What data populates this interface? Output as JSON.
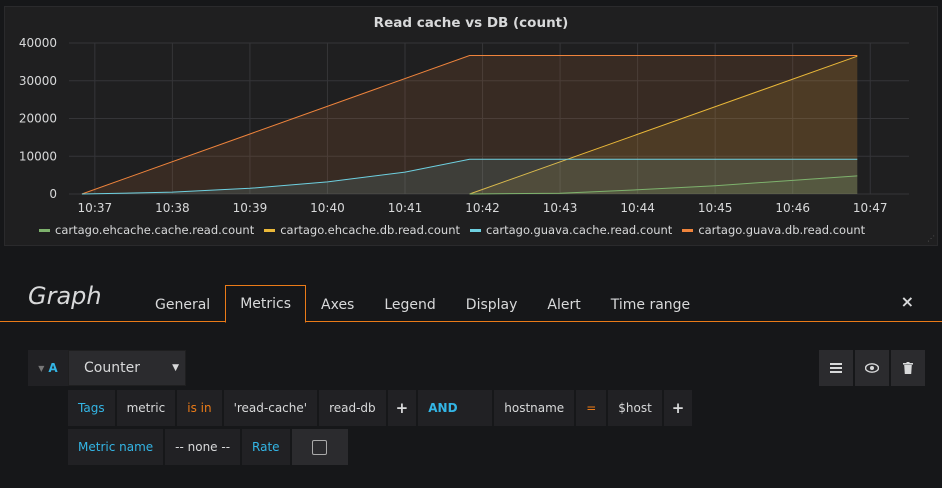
{
  "panel": {
    "title": "Read cache vs DB (count)"
  },
  "chart_data": {
    "type": "area",
    "title": "Read cache vs DB (count)",
    "xlabel": "",
    "ylabel": "",
    "ylim": [
      0,
      40000
    ],
    "yticks": [
      0,
      10000,
      20000,
      30000,
      40000
    ],
    "yticklabels": [
      "0",
      "10000",
      "20000",
      "30000",
      "40000"
    ],
    "xlim": [
      "10:36:40",
      "10:47:30"
    ],
    "xticklabels": [
      "10:37",
      "10:38",
      "10:39",
      "10:40",
      "10:41",
      "10:42",
      "10:43",
      "10:44",
      "10:45",
      "10:46",
      "10:47"
    ],
    "grid": true,
    "legend_position": "bottom-left",
    "series": [
      {
        "name": "cartago.ehcache.cache.read.count",
        "color": "#7eb26d",
        "points": [
          [
            "10:41:50",
            0
          ],
          [
            "10:43",
            200
          ],
          [
            "10:44",
            1100
          ],
          [
            "10:45",
            2200
          ],
          [
            "10:46",
            3600
          ],
          [
            "10:46:50",
            4800
          ]
        ]
      },
      {
        "name": "cartago.ehcache.db.read.count",
        "color": "#eab839",
        "points": [
          [
            "10:41:50",
            0
          ],
          [
            "10:46:50",
            36500
          ]
        ]
      },
      {
        "name": "cartago.guava.cache.read.count",
        "color": "#6ed0e0",
        "points": [
          [
            "10:36:50",
            0
          ],
          [
            "10:37",
            50
          ],
          [
            "10:38",
            500
          ],
          [
            "10:39",
            1500
          ],
          [
            "10:40",
            3200
          ],
          [
            "10:41",
            5800
          ],
          [
            "10:41:50",
            9200
          ],
          [
            "10:46:50",
            9200
          ]
        ]
      },
      {
        "name": "cartago.guava.db.read.count",
        "color": "#ef843c",
        "points": [
          [
            "10:36:50",
            0
          ],
          [
            "10:41:50",
            36700
          ],
          [
            "10:46:50",
            36700
          ]
        ]
      }
    ]
  },
  "editor": {
    "title": "Graph",
    "tabs": [
      "General",
      "Metrics",
      "Axes",
      "Legend",
      "Display",
      "Alert",
      "Time range"
    ],
    "active_tab": "Metrics",
    "close_icon": "×"
  },
  "query": {
    "ref_id": "A",
    "aggregator": "Counter",
    "tags_label": "Tags",
    "tag_key": "metric",
    "operator": "is in",
    "values": [
      "'read-cache'",
      "read-db"
    ],
    "plus_label": "+",
    "and_label": "AND",
    "tag_key2": "hostname",
    "operator2": "=",
    "value2": "$host",
    "plus2_label": "+",
    "metric_name_label": "Metric name",
    "metric_name_value": "-- none --",
    "rate_label": "Rate",
    "rate_checked": false
  }
}
